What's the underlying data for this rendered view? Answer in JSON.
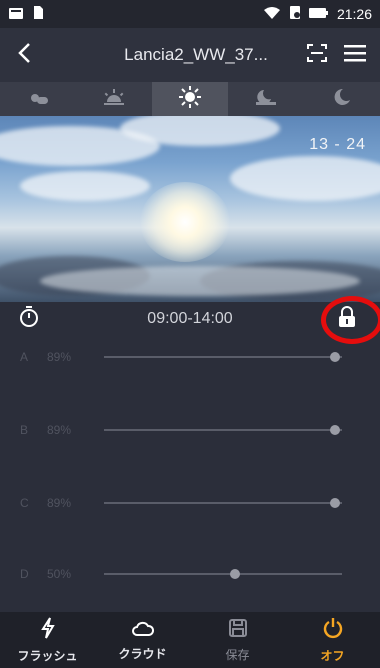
{
  "status_bar": {
    "time": "21:26",
    "icons": [
      "sim-icon",
      "notification-icon",
      "wifi-icon",
      "battery-saver-icon",
      "battery-icon"
    ]
  },
  "app_bar": {
    "title": "Lancia2_WW_37...",
    "icons": [
      "back-arrow-icon",
      "scan-icon",
      "hamburger-menu-icon"
    ]
  },
  "tabs": [
    {
      "icon": "sunrise-icon",
      "active": false
    },
    {
      "icon": "morning-sun-icon",
      "active": false
    },
    {
      "icon": "sun-icon",
      "active": true
    },
    {
      "icon": "sunset-icon",
      "active": false
    },
    {
      "icon": "moon-icon",
      "active": false
    }
  ],
  "hero": {
    "time_text": "13 - 24"
  },
  "schedule": {
    "time_range": "09:00-14:00",
    "timer_icon": "timer-icon",
    "lock_icon": "lock-icon"
  },
  "channels": [
    {
      "label": "A",
      "value": "89%",
      "level": 0.97
    },
    {
      "label": "B",
      "value": "89%",
      "level": 0.97
    },
    {
      "label": "C",
      "value": "89%",
      "level": 0.97
    },
    {
      "label": "D",
      "value": "50%",
      "level": 0.55
    }
  ],
  "bottom_nav": [
    {
      "label": "フラッシュ",
      "icon": "flash-icon"
    },
    {
      "label": "クラウド",
      "icon": "cloud-icon"
    },
    {
      "label": "保存",
      "icon": "save-icon"
    },
    {
      "label": "オフ",
      "icon": "power-icon"
    }
  ],
  "colors": {
    "background": "#2b2e3a",
    "accent_off": "#f5a623",
    "highlight_ring": "#e50d0d"
  }
}
